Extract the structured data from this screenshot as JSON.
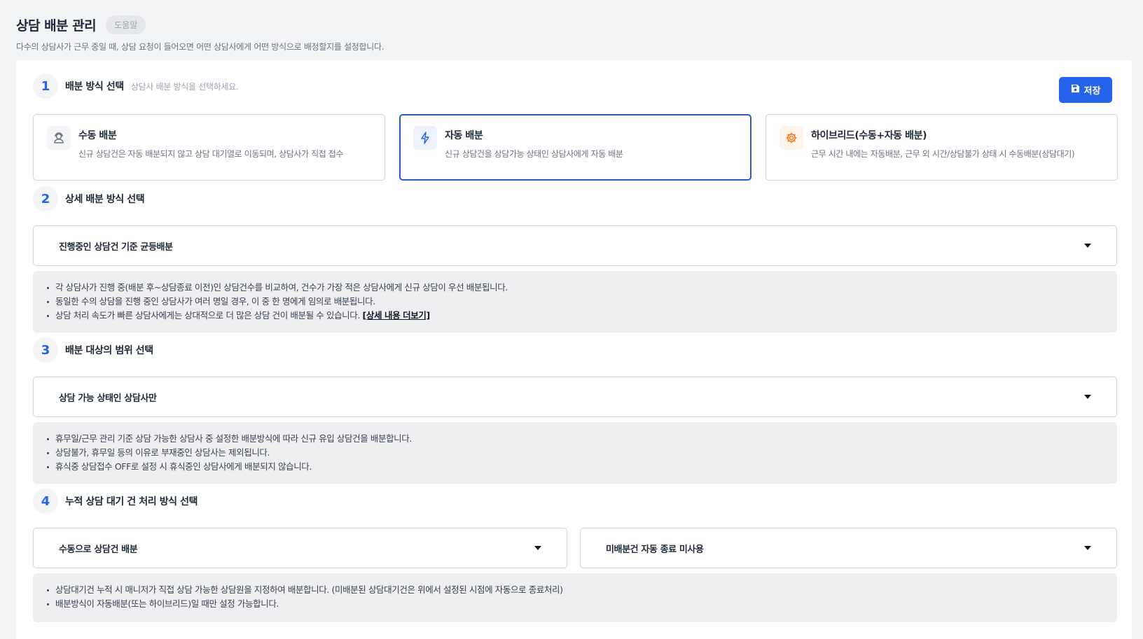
{
  "page": {
    "title": "상담 배분 관리",
    "help_label": "도움말",
    "description": "다수의 상담사가 근무 중일 때, 상담 요청이 들어오면 어떤 상담사에게 어떤 방식으로 배정할지를 설정합니다."
  },
  "save_button": {
    "label": "저장",
    "icon": "save-icon"
  },
  "step1": {
    "number": "1",
    "title": "배분 방식 선택",
    "subtitle": "상담사 배분 방식을 선택하세요.",
    "options": [
      {
        "title": "수동 배분",
        "desc": "신규 상담건은 자동 배분되지 않고 상담 대기열로 이동되며, 상담사가 직접 접수",
        "icon": "agent-icon",
        "selected": false
      },
      {
        "title": "자동 배분",
        "desc": "신규 상담건을 상담가능 상태인 상담사에게 자동 배분",
        "icon": "lightning-icon",
        "selected": true
      },
      {
        "title": "하이브리드(수동+자동 배분)",
        "desc": "근무 시간 내에는 자동배분, 근무 외 시간/상담불가 상태 시 수동배분(상담대기)",
        "icon": "gear-icon",
        "selected": false
      }
    ]
  },
  "step2": {
    "number": "2",
    "title": "상세 배분 방식 선택",
    "select_value": "진행중인 상담건 기준 균등배분",
    "notes": [
      "각 상담사가 진행 중(배분 후~상담종료 이전)인 상담건수를 비교하여, 건수가 가장 적은 상담사에게 신규 상담이 우선 배분됩니다.",
      "동일한 수의 상담을 진행 중인 상담사가 여러 명일 경우, 이 중 한 명에게 임의로 배분됩니다.",
      "상담 처리 속도가 빠른 상담사에게는 상대적으로 더 많은 상담 건이 배분될 수 있습니다."
    ],
    "more_link": "[상세 내용 더보기]"
  },
  "step3": {
    "number": "3",
    "title": "배분 대상의 범위 선택",
    "select_value": "상담 가능 상태인 상담사만",
    "notes": [
      "휴무일/근무 관리 기준 상담 가능한 상담사 중 설정한 배분방식에 따라 신규 유입 상담건을 배분합니다.",
      "상담불가, 휴무일 등의 이유로 부재중인 상담사는 제외됩니다.",
      "휴식중 상담접수 OFF로 설정 시 휴식중인 상담사에게 배분되지 않습니다."
    ]
  },
  "step4": {
    "number": "4",
    "title": "누적 상담 대기 건 처리 방식 선택",
    "select_left_value": "수동으로 상담건 배분",
    "select_right_value": "미배분건 자동 종료 미사용",
    "notes": [
      "상담대기건 누적 시 매니저가 직접 상담 가능한 상담원을 지정하여 배분합니다. (미배분된 상담대기건은 위에서 설정된 시점에 자동으로 종료처리)",
      "배분방식이 자동배분(또는 하이브리드)일 때만 설정 가능합니다."
    ]
  },
  "colors": {
    "accent": "#2563eb",
    "selected_border": "#2b5cc6",
    "notes_bg": "#efeff1",
    "hybrid_icon": "#f97316"
  }
}
